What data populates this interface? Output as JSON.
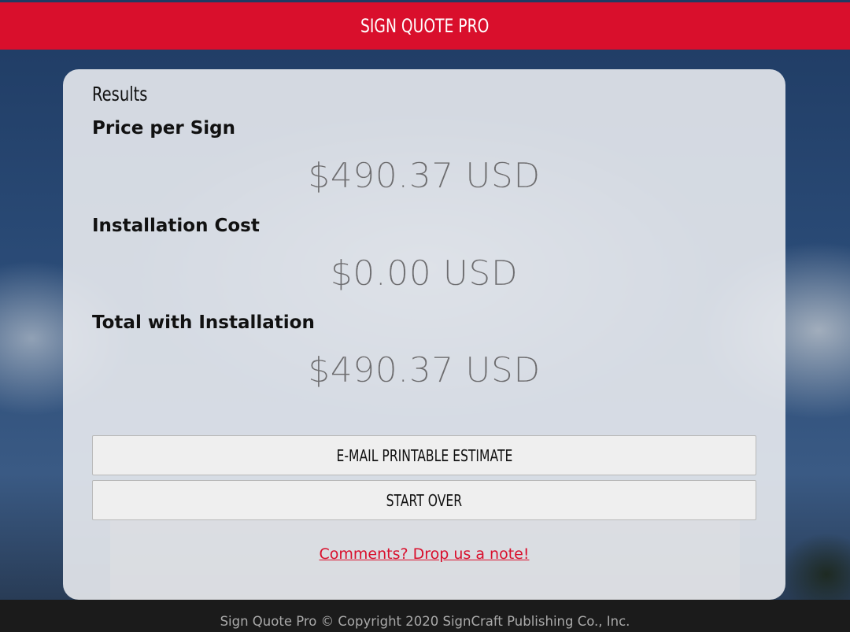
{
  "header": {
    "title": "SIGN QUOTE PRO"
  },
  "results": {
    "heading": "Results",
    "price_per_sign": {
      "label": "Price per Sign",
      "value": "$490.37 USD"
    },
    "installation_cost": {
      "label": "Installation Cost",
      "value": "$0.00 USD"
    },
    "total_with_installation": {
      "label": "Total with Installation",
      "value": "$490.37 USD"
    }
  },
  "actions": {
    "email_label": "E-MAIL PRINTABLE ESTIMATE",
    "start_over_label": "START OVER",
    "comments_link": "Comments? Drop us a note!"
  },
  "footer": {
    "copyright": "Sign Quote Pro © Copyright 2020 SignCraft Publishing Co., Inc."
  },
  "colors": {
    "brand_red": "#d90f2c",
    "footer_bg": "#1b1b1b",
    "value_gray": "#6d6d70"
  }
}
